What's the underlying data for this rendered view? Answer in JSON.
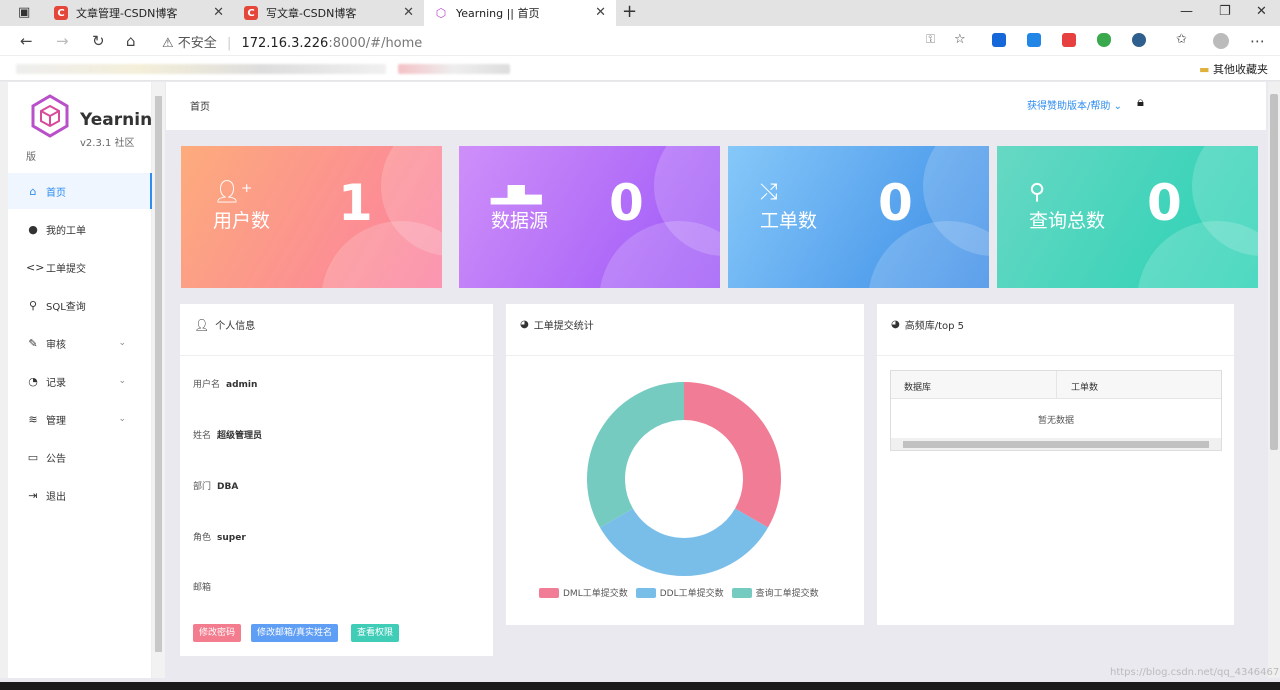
{
  "browser": {
    "tabs": [
      {
        "title": "文章管理-CSDN博客",
        "favicon": "C"
      },
      {
        "title": "写文章-CSDN博客",
        "favicon": "C"
      },
      {
        "title": "Yearning || 首页",
        "favicon": "hex"
      }
    ],
    "new_tab": "+",
    "security": "不安全",
    "url_host": "172.16.3.226",
    "url_rest": ":8000/#/home",
    "bookmarks_other": "其他收藏夹"
  },
  "sidebar": {
    "brand": "Yearning",
    "version": "v2.3.1 社区",
    "version_suffix": "版",
    "items": [
      {
        "label": "首页",
        "icon": "home-icon",
        "active": true
      },
      {
        "label": "我的工单",
        "icon": "person-icon"
      },
      {
        "label": "工单提交",
        "icon": "code-icon"
      },
      {
        "label": "SQL查询",
        "icon": "search-icon"
      },
      {
        "label": "审核",
        "icon": "edit-icon",
        "expandable": true
      },
      {
        "label": "记录",
        "icon": "pie-icon",
        "expandable": true
      },
      {
        "label": "管理",
        "icon": "layers-icon",
        "expandable": true
      },
      {
        "label": "公告",
        "icon": "clipboard-icon"
      },
      {
        "label": "退出",
        "icon": "logout-icon"
      }
    ]
  },
  "header": {
    "breadcrumb": "首页",
    "help": "获得赞助版本/帮助"
  },
  "stats": [
    {
      "label": "用户数",
      "value": "1",
      "icon": "user-add-icon",
      "gradient": [
        "#fda77f",
        "#fb7ea2"
      ]
    },
    {
      "label": "数据源",
      "value": "0",
      "icon": "bar-icon",
      "gradient": [
        "#cc8df9",
        "#9e58f8"
      ]
    },
    {
      "label": "工单数",
      "value": "0",
      "icon": "shuffle-icon",
      "gradient": [
        "#7dc3f8",
        "#3c8ce7"
      ]
    },
    {
      "label": "查询总数",
      "value": "0",
      "icon": "search-icon",
      "gradient": [
        "#5fd6c0",
        "#2bd2b6"
      ]
    }
  ],
  "profile": {
    "title": "个人信息",
    "rows": [
      {
        "key": "用户名",
        "value": "admin"
      },
      {
        "key": "姓名",
        "value": "超级管理员"
      },
      {
        "key": "部门",
        "value": "DBA"
      },
      {
        "key": "角色",
        "value": "super"
      },
      {
        "key": "邮箱",
        "value": ""
      }
    ],
    "buttons": [
      {
        "label": "修改密码",
        "color": "#f37c8e"
      },
      {
        "label": "修改邮箱/真实姓名",
        "color": "#5f9ef5"
      },
      {
        "label": "查看权限",
        "color": "#40cdb8"
      }
    ]
  },
  "order_stats": {
    "title": "工单提交统计"
  },
  "top5": {
    "title": "高频库/top 5",
    "columns": [
      "数据库",
      "工单数"
    ],
    "empty": "暂无数据"
  },
  "chart_data": {
    "type": "pie",
    "donut": true,
    "series": [
      {
        "name": "DML工单提交数",
        "value": 1,
        "color": "#f07c96"
      },
      {
        "name": "DDL工单提交数",
        "value": 1,
        "color": "#79bde9"
      },
      {
        "name": "查询工单提交数",
        "value": 1,
        "color": "#76cbc0"
      }
    ],
    "legend": "bottom"
  },
  "watermark": "https://blog.csdn.net/qq_4346467"
}
